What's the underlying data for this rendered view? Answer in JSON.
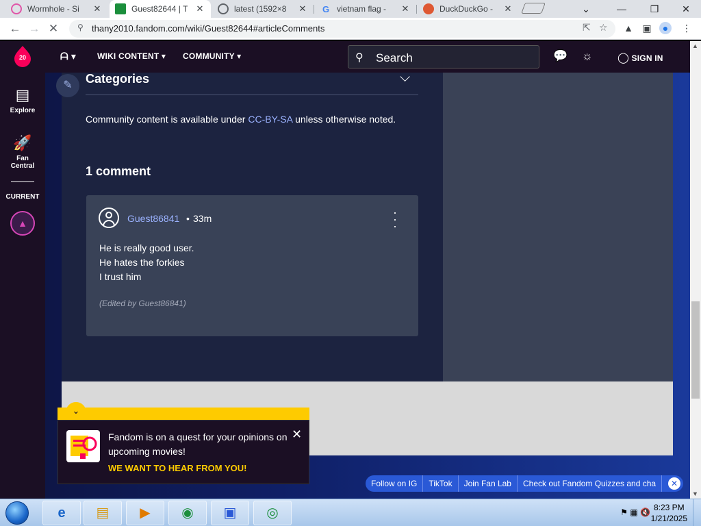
{
  "browser": {
    "tabs": [
      {
        "title": "Wormhole - Si",
        "active": false,
        "icon": "flower-icon",
        "color": "#e056a8"
      },
      {
        "title": "Guest82644 | T",
        "active": true,
        "icon": "fandom-icon",
        "color": "#1b8f3c"
      },
      {
        "title": "latest (1592×8",
        "active": false,
        "icon": "globe-icon",
        "color": "#5f6368"
      },
      {
        "title": "vietnam flag -",
        "active": false,
        "icon": "google-icon",
        "color": "#4285f4"
      },
      {
        "title": "DuckDuckGo -",
        "active": false,
        "icon": "duckduckgo-icon",
        "color": "#de5833"
      }
    ],
    "url": "thany2010.fandom.com/wiki/Guest82644#articleComments"
  },
  "fandom": {
    "nav": {
      "wiki_content": "WIKI CONTENT",
      "community": "COMMUNITY",
      "search_placeholder": "Search",
      "sign_in": "SIGN IN"
    },
    "rail": {
      "logo_number": "20",
      "explore": "Explore",
      "fan_central_line1": "Fan",
      "fan_central_line2": "Central",
      "current": "CURRENT"
    },
    "categories": {
      "title": "Categories"
    },
    "license": {
      "prefix": "Community content is available under ",
      "link": "CC-BY-SA",
      "suffix": " unless otherwise noted."
    },
    "comments": {
      "heading": "1 comment",
      "items": [
        {
          "author": "Guest86841",
          "separator": "•",
          "time": "33m",
          "lines": [
            "He is really good user.",
            "He hates the forkies",
            "I trust him"
          ],
          "edited": "(Edited by Guest86841)"
        }
      ]
    },
    "popup": {
      "text": "Fandom is on a quest for your opinions on upcoming movies!",
      "cta": "WE WANT TO HEAR FROM YOU!"
    },
    "social": {
      "items": [
        "Follow on IG",
        "TikTok",
        "Join Fan Lab",
        "Check out Fandom Quizzes and cha"
      ]
    }
  },
  "taskbar": {
    "time": "8:23 PM",
    "date": "1/21/2025"
  },
  "colors": {
    "link": "#9bb2ff",
    "accent_yellow": "#fecb00",
    "social_blue": "#2a59d6"
  }
}
